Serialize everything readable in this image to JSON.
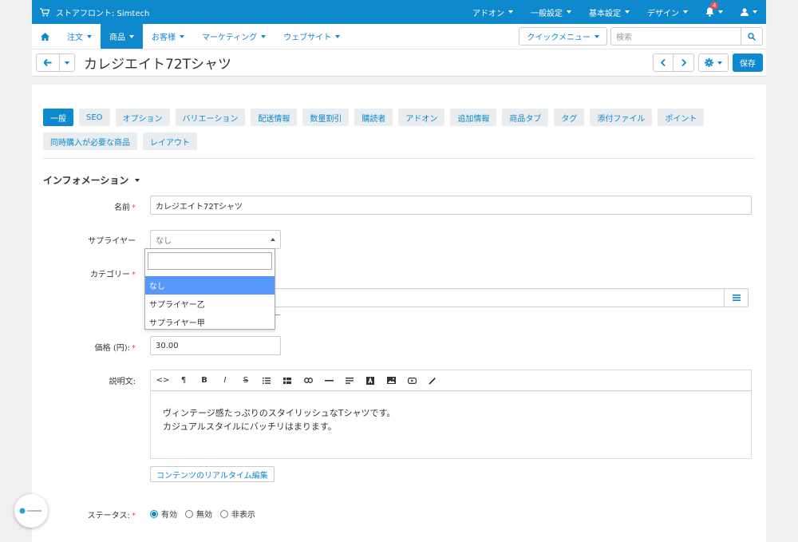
{
  "topbar": {
    "store_title": "ストアフロント: Simtech",
    "menus": [
      "アドオン",
      "一般設定",
      "基本設定",
      "デザイン"
    ],
    "notifications_count": "4"
  },
  "nav": {
    "items": [
      "注文",
      "商品",
      "お客様",
      "マーケティング",
      "ウェブサイト"
    ],
    "active_index": 1,
    "quick_menu_label": "クイックメニュー",
    "search_placeholder": "検索"
  },
  "titlebar": {
    "title": "カレジエイト72Tシャツ",
    "save_label": "保存"
  },
  "tabs": [
    "一般",
    "SEO",
    "オプション",
    "バリエーション",
    "配送情報",
    "数量割引",
    "購読者",
    "アドオン",
    "追加情報",
    "商品タブ",
    "タグ",
    "添付ファイル",
    "ポイント",
    "同時購入が必要な商品",
    "レイアウト"
  ],
  "section_title": "インフォメーション",
  "form": {
    "name_label": "名前",
    "name_value": "カレジエイト72Tシャツ",
    "supplier_label": "サプライヤー",
    "supplier_value": "なし",
    "supplier_options": [
      "なし",
      "サプライヤー乙",
      "サプライヤー甲"
    ],
    "category_label": "カテゴリー",
    "price_label": "価格 (円):",
    "price_value": "30.00",
    "description_label": "説明文:",
    "description_lines": [
      "ヴィンテージ感たっぷりのスタイリッシュなTシャツです。",
      "カジュアルスタイルにバッチリはまります。"
    ],
    "rte_button_label": "コンテンツのリアルタイム編集",
    "status_label": "ステータス:",
    "status_options": [
      "有効",
      "無効",
      "非表示"
    ]
  },
  "colors": {
    "accent": "#0e89cd",
    "required": "#d9534f",
    "dropdown_selected": "#5897fb"
  }
}
